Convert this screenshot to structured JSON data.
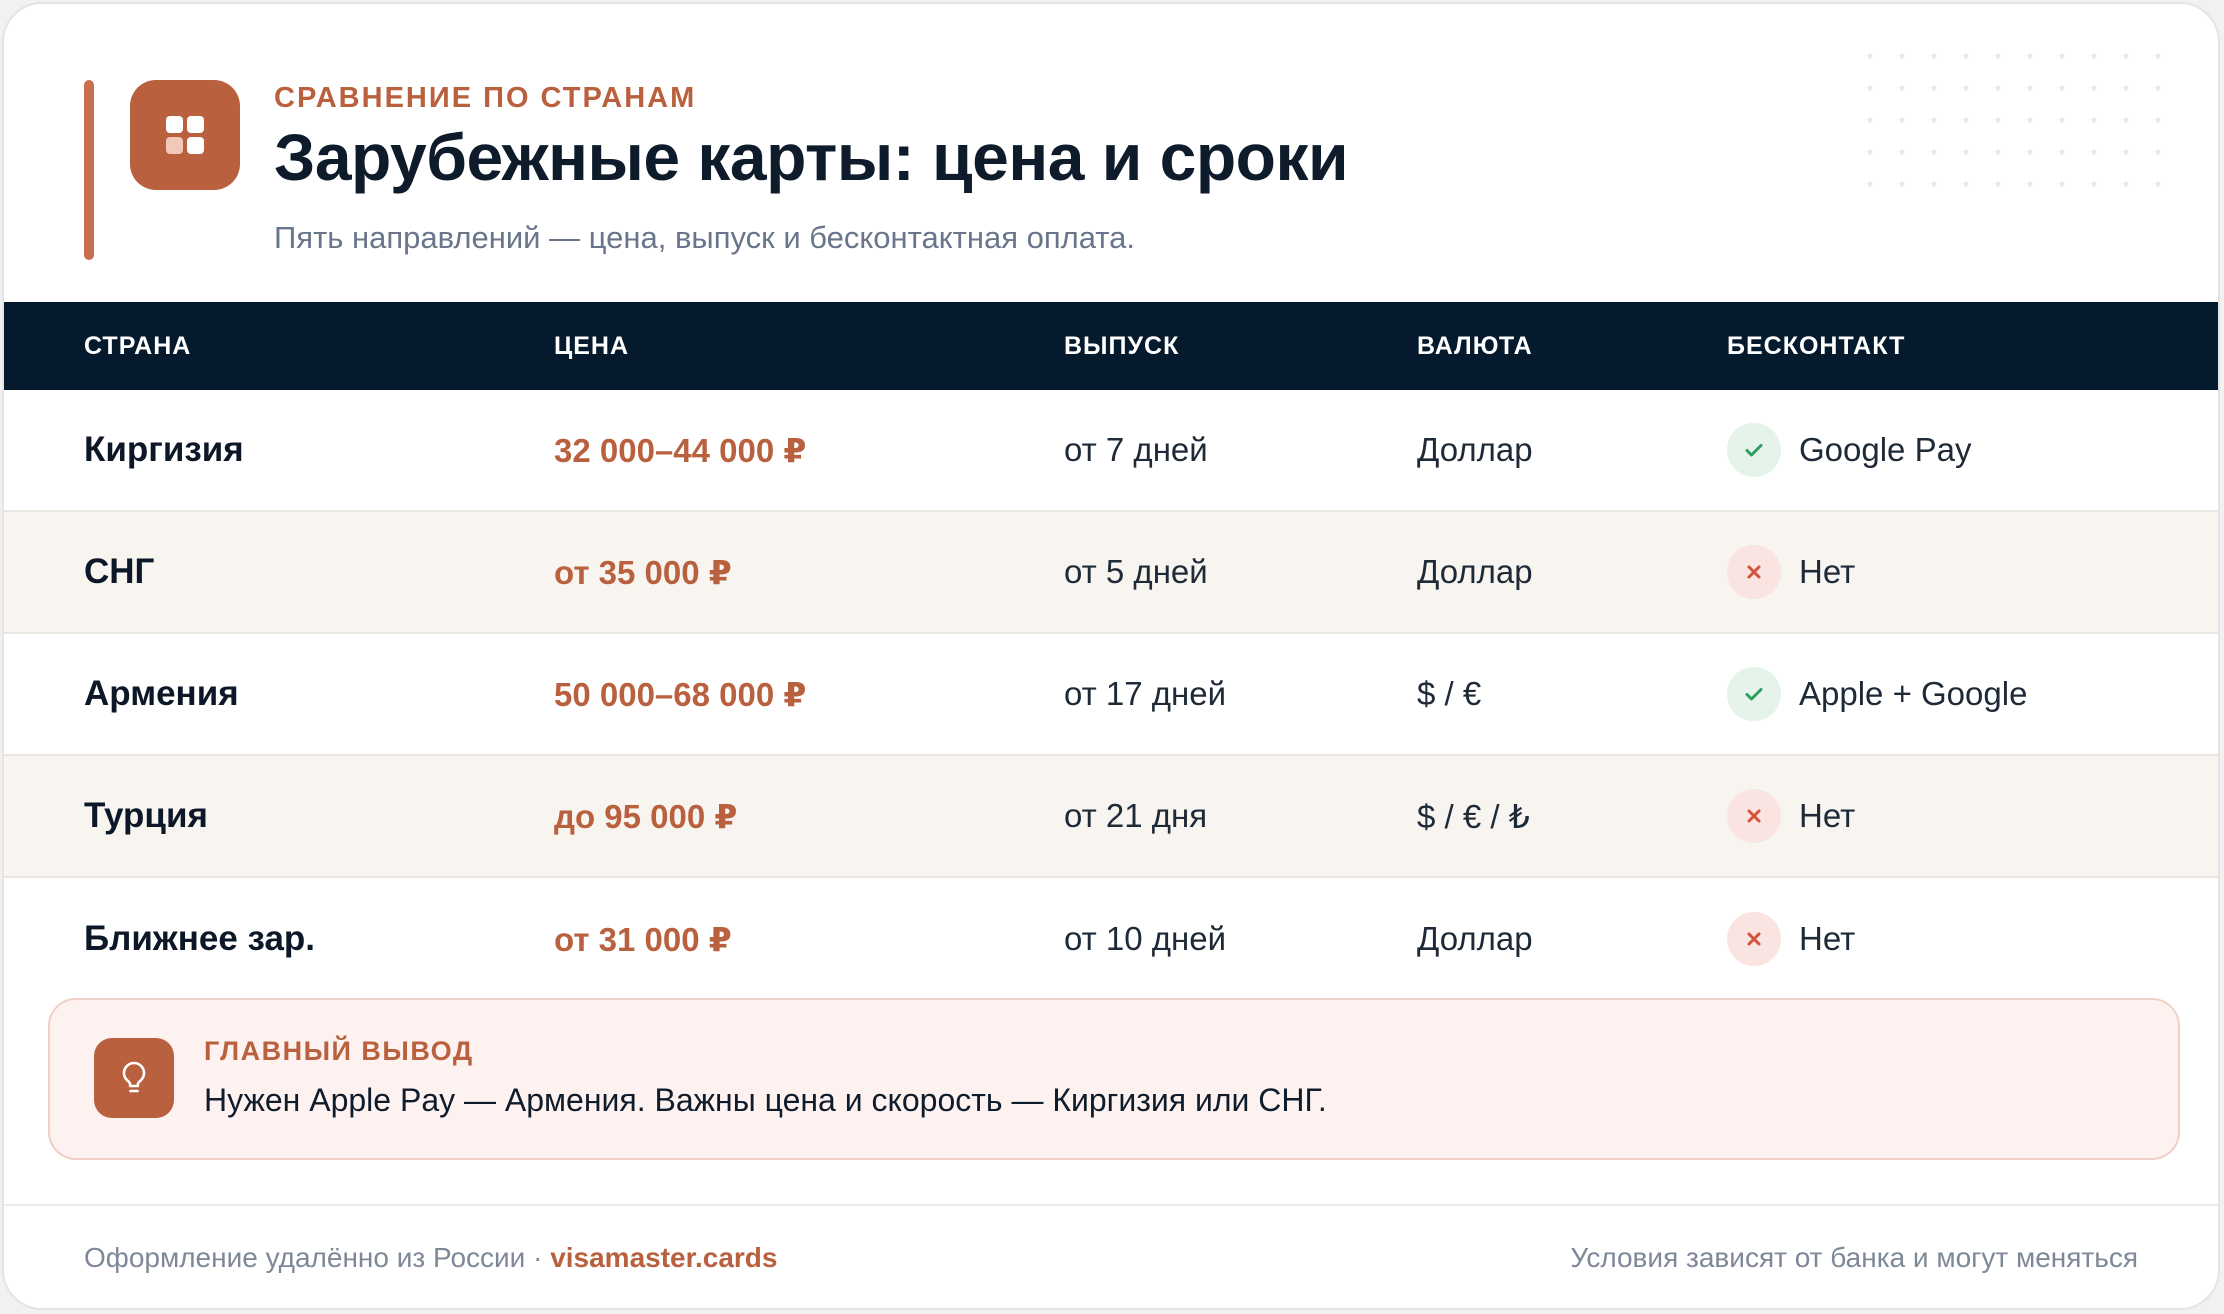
{
  "header": {
    "eyebrow": "СРАВНЕНИЕ ПО СТРАНАМ",
    "title": "Зарубежные карты: цена и сроки",
    "subtitle": "Пять направлений — цена, выпуск и бесконтактная оплата.",
    "logo_icon": "grid-icon"
  },
  "table": {
    "columns": [
      "СТРАНА",
      "ЦЕНА",
      "ВЫПУСК",
      "ВАЛЮТА",
      "БЕСКОНТАКТ"
    ],
    "rows": [
      {
        "country": "Киргизия",
        "price": "32 000–44 000 ₽",
        "issue": "от 7 дней",
        "currency": "Доллар",
        "contactless": "Google Pay",
        "contactless_ok": true
      },
      {
        "country": "СНГ",
        "price": "от 35 000 ₽",
        "issue": "от 5 дней",
        "currency": "Доллар",
        "contactless": "Нет",
        "contactless_ok": false
      },
      {
        "country": "Армения",
        "price": "50 000–68 000 ₽",
        "issue": "от 17 дней",
        "currency": "$ / €",
        "contactless": "Apple + Google",
        "contactless_ok": true
      },
      {
        "country": "Турция",
        "price": "до 95 000 ₽",
        "issue": "от 21 дня",
        "currency": "$ / € / ₺",
        "contactless": "Нет",
        "contactless_ok": false
      },
      {
        "country": "Ближнее зар.",
        "price": "от 31 000 ₽",
        "issue": "от 10 дней",
        "currency": "Доллар",
        "contactless": "Нет",
        "contactless_ok": false
      }
    ]
  },
  "callout": {
    "icon": "lightbulb-icon",
    "label": "ГЛАВНЫЙ ВЫВОД",
    "text": "Нужен Apple Pay — Армения. Важны цена и скорость — Киргизия или СНГ."
  },
  "footer": {
    "left_text": "Оформление удалённо из России · ",
    "link_text": "visamaster.cards",
    "right_text": "Условия зависят от банка и могут меняться"
  },
  "colors": {
    "accent": "#b9603e",
    "header_bg": "#051a2d",
    "yes": "#2e9e5e",
    "no": "#d2533e"
  }
}
